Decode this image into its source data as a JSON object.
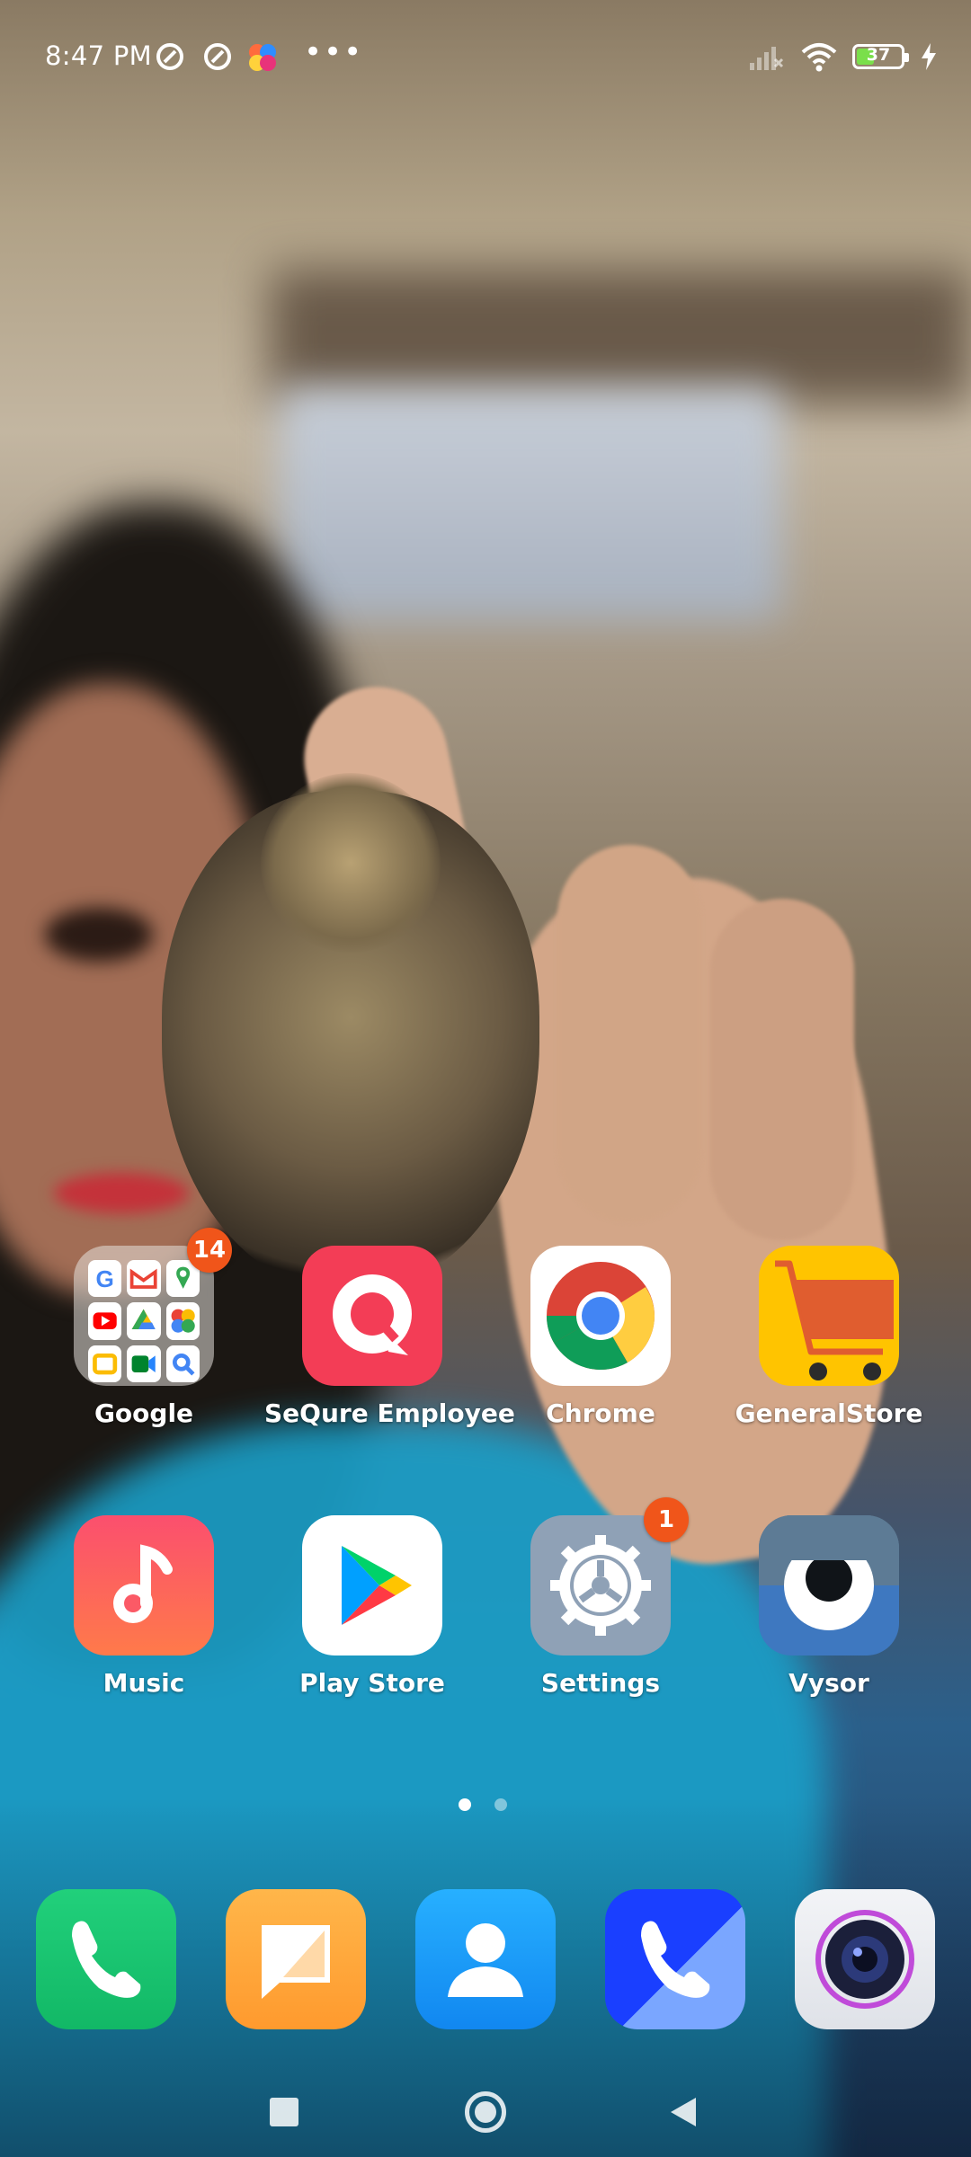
{
  "status_bar": {
    "time": "8:47 PM",
    "more": "•••",
    "battery_level": "37",
    "battery_fraction": 0.37,
    "battery_color": "#7adf4b"
  },
  "home_apps": [
    {
      "label": "Google",
      "icon": "folder-icon",
      "badge": "14"
    },
    {
      "label": "SeQure Employee",
      "icon": "sequre-icon",
      "badge": ""
    },
    {
      "label": "Chrome",
      "icon": "chrome-icon",
      "badge": ""
    },
    {
      "label": "GeneralStore",
      "icon": "cart-icon",
      "badge": ""
    },
    {
      "label": "Music",
      "icon": "music-note-icon",
      "badge": ""
    },
    {
      "label": "Play Store",
      "icon": "play-store-icon",
      "badge": ""
    },
    {
      "label": "Settings",
      "icon": "gear-icon",
      "badge": "1"
    },
    {
      "label": "Vysor",
      "icon": "vysor-eye-icon",
      "badge": ""
    }
  ],
  "pager": {
    "pages": 2,
    "active": 1
  },
  "dock": [
    {
      "name": "phone",
      "icon": "phone-icon"
    },
    {
      "name": "messages",
      "icon": "message-icon"
    },
    {
      "name": "contacts",
      "icon": "contacts-icon"
    },
    {
      "name": "caller",
      "icon": "phone-icon"
    },
    {
      "name": "camera",
      "icon": "camera-icon"
    }
  ],
  "nav": [
    "recents-button",
    "home-button",
    "back-button"
  ],
  "colors": {
    "badge": "#f0551a",
    "sequre": "#f33d56",
    "music_top": "#fb4f6e",
    "settings": "#8fa1b6",
    "vysor": "#3e78c0"
  }
}
